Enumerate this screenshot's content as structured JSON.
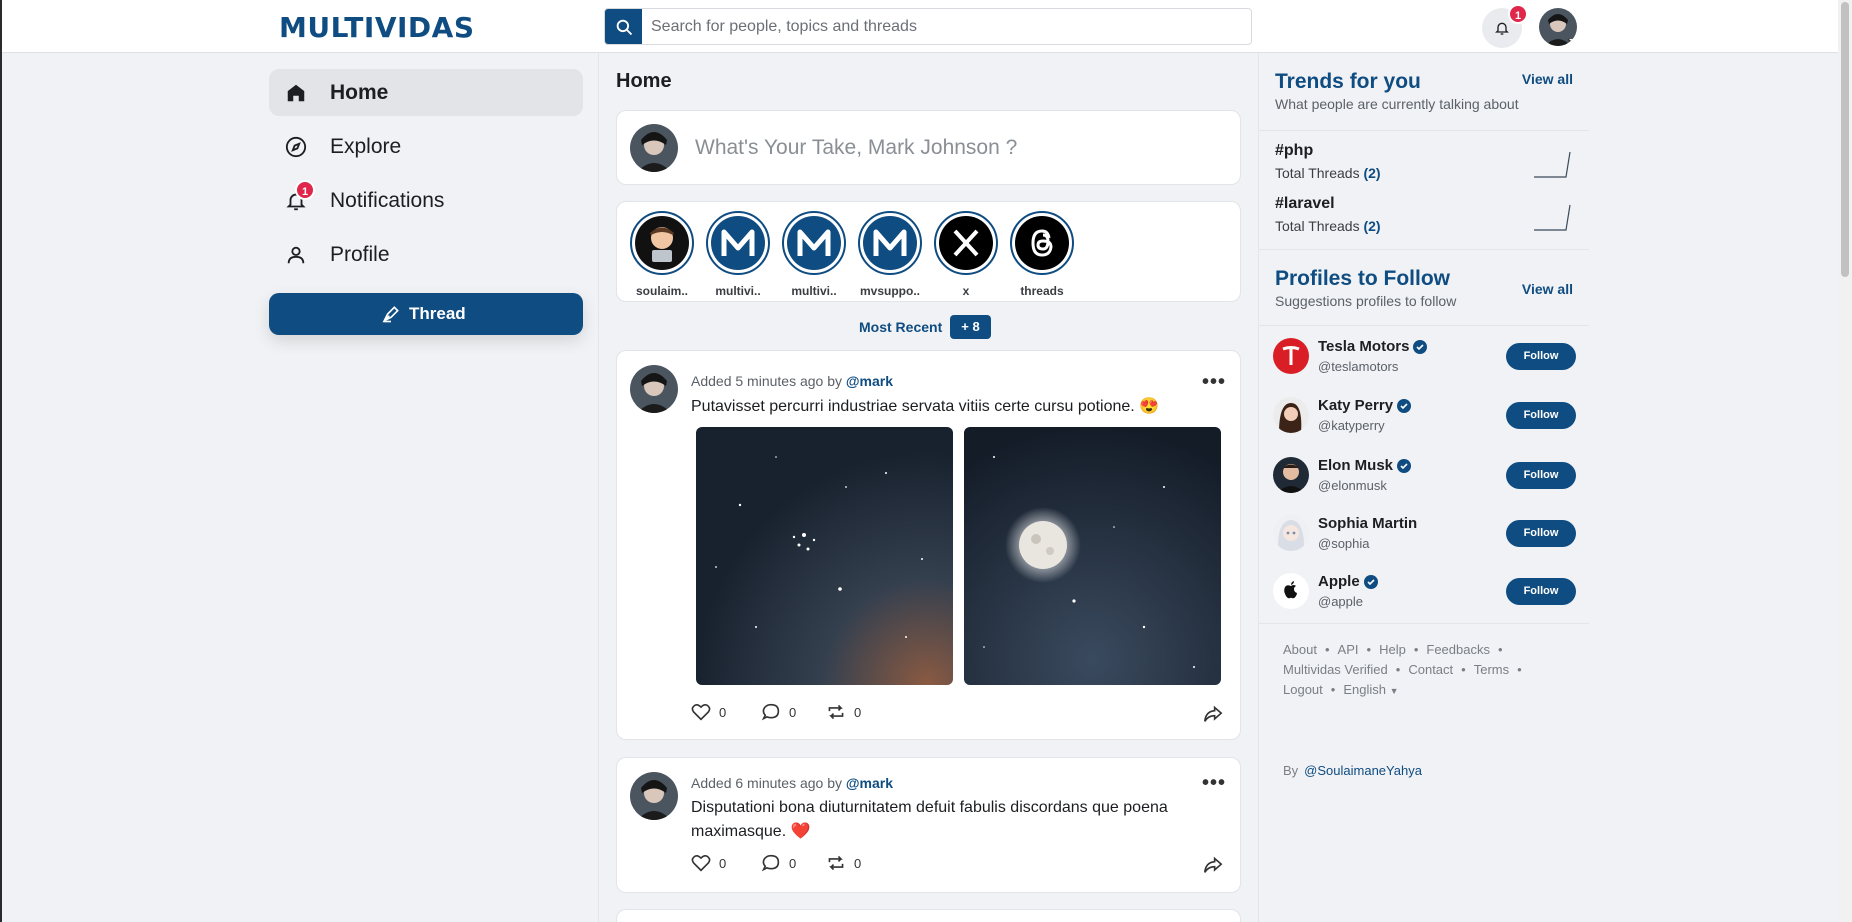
{
  "header": {
    "logo": "MULTIVIDAS",
    "search_placeholder": "Search for people, topics and threads",
    "notification_count": "1"
  },
  "nav": {
    "items": [
      {
        "label": "Home",
        "icon": "home-icon"
      },
      {
        "label": "Explore",
        "icon": "compass-icon"
      },
      {
        "label": "Notifications",
        "icon": "bell-icon",
        "badge": "1"
      },
      {
        "label": "Profile",
        "icon": "user-icon"
      }
    ],
    "thread_button": "Thread"
  },
  "main": {
    "title": "Home",
    "compose_placeholder": "What's Your Take, Mark Johnson ?",
    "stories": [
      {
        "name": "soulaim.."
      },
      {
        "name": "multivi.."
      },
      {
        "name": "multivi.."
      },
      {
        "name": "mvsuppo.."
      },
      {
        "name": "x"
      },
      {
        "name": "threads"
      }
    ],
    "recent_label": "Most Recent",
    "recent_badge": "+ 8",
    "posts": [
      {
        "meta_prefix": "Added 5 minutes ago by",
        "author": "@mark",
        "text": "Putavisset percurri industriae servata vitiis certe cursu potione. 😍",
        "likes": "0",
        "comments": "0",
        "reposts": "0"
      },
      {
        "meta_prefix": "Added 6 minutes ago by",
        "author": "@mark",
        "text": "Disputationi bona diuturnitatem defuit fabulis discordans que poena maximasque. ❤️",
        "likes": "0",
        "comments": "0",
        "reposts": "0"
      }
    ]
  },
  "sidebar": {
    "trends_title": "Trends for you",
    "trends_sub": "What people are currently talking about",
    "view_all": "View all",
    "trends": [
      {
        "tag": "#php",
        "label": "Total Threads",
        "count": "(2)"
      },
      {
        "tag": "#laravel",
        "label": "Total Threads",
        "count": "(2)"
      }
    ],
    "profiles_title": "Profiles to Follow",
    "profiles_sub": "Suggestions profiles to follow",
    "follow_label": "Follow",
    "profiles": [
      {
        "name": "Tesla Motors",
        "handle": "@teslamotors",
        "verified": true
      },
      {
        "name": "Katy Perry",
        "handle": "@katyperry",
        "verified": true
      },
      {
        "name": "Elon Musk",
        "handle": "@elonmusk",
        "verified": true
      },
      {
        "name": "Sophia Martin",
        "handle": "@sophia",
        "verified": false
      },
      {
        "name": "Apple",
        "handle": "@apple",
        "verified": true
      }
    ],
    "footer_links": {
      "about": "About",
      "api": "API",
      "help": "Help",
      "feedbacks": "Feedbacks",
      "verified": "Multividas Verified",
      "contact": "Contact",
      "terms": "Terms",
      "logout": "Logout",
      "language": "English"
    },
    "footer_by": "By",
    "footer_author": "@SoulaimaneYahya"
  },
  "colors": {
    "accent": "#0f4c81",
    "badge": "#e0264a",
    "background": "#f0f2f5"
  }
}
